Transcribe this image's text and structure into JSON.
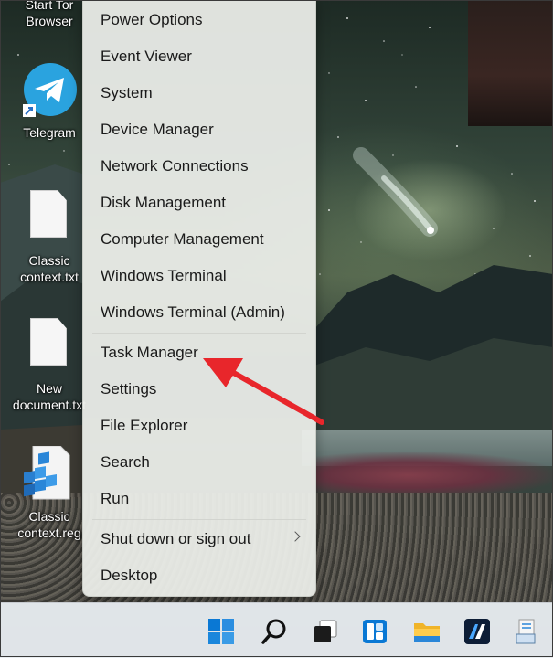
{
  "desktop_icons": [
    {
      "id": "tor",
      "label_line1": "Start Tor",
      "label_line2": "Browser"
    },
    {
      "id": "telegram",
      "label_line1": "Telegram"
    },
    {
      "id": "classic-txt",
      "label_line1": "Classic",
      "label_line2": "context.txt"
    },
    {
      "id": "new-doc",
      "label_line1": "New",
      "label_line2": "document.txt"
    },
    {
      "id": "classic-reg",
      "label_line1": "Classic",
      "label_line2": "context.reg"
    }
  ],
  "menu": {
    "items": [
      "Power Options",
      "Event Viewer",
      "System",
      "Device Manager",
      "Network Connections",
      "Disk Management",
      "Computer Management",
      "Windows Terminal",
      "Windows Terminal (Admin)",
      "Task Manager",
      "Settings",
      "File Explorer",
      "Search",
      "Run",
      "Shut down or sign out",
      "Desktop"
    ],
    "submenu_item": "Shut down or sign out"
  },
  "taskbar": {
    "icons": [
      "windows-start-icon",
      "search-icon",
      "task-view-icon",
      "widgets-icon",
      "file-explorer-icon",
      "app-icon",
      "desktop-app-icon"
    ]
  },
  "annotation": {
    "color": "#e8262b",
    "target": "Task Manager"
  },
  "colors": {
    "menu_bg": "#eef0ec",
    "taskbar_bg": "#e8ecf0",
    "win_blue": "#0a78d4",
    "telegram_blue": "#2aa3df"
  }
}
